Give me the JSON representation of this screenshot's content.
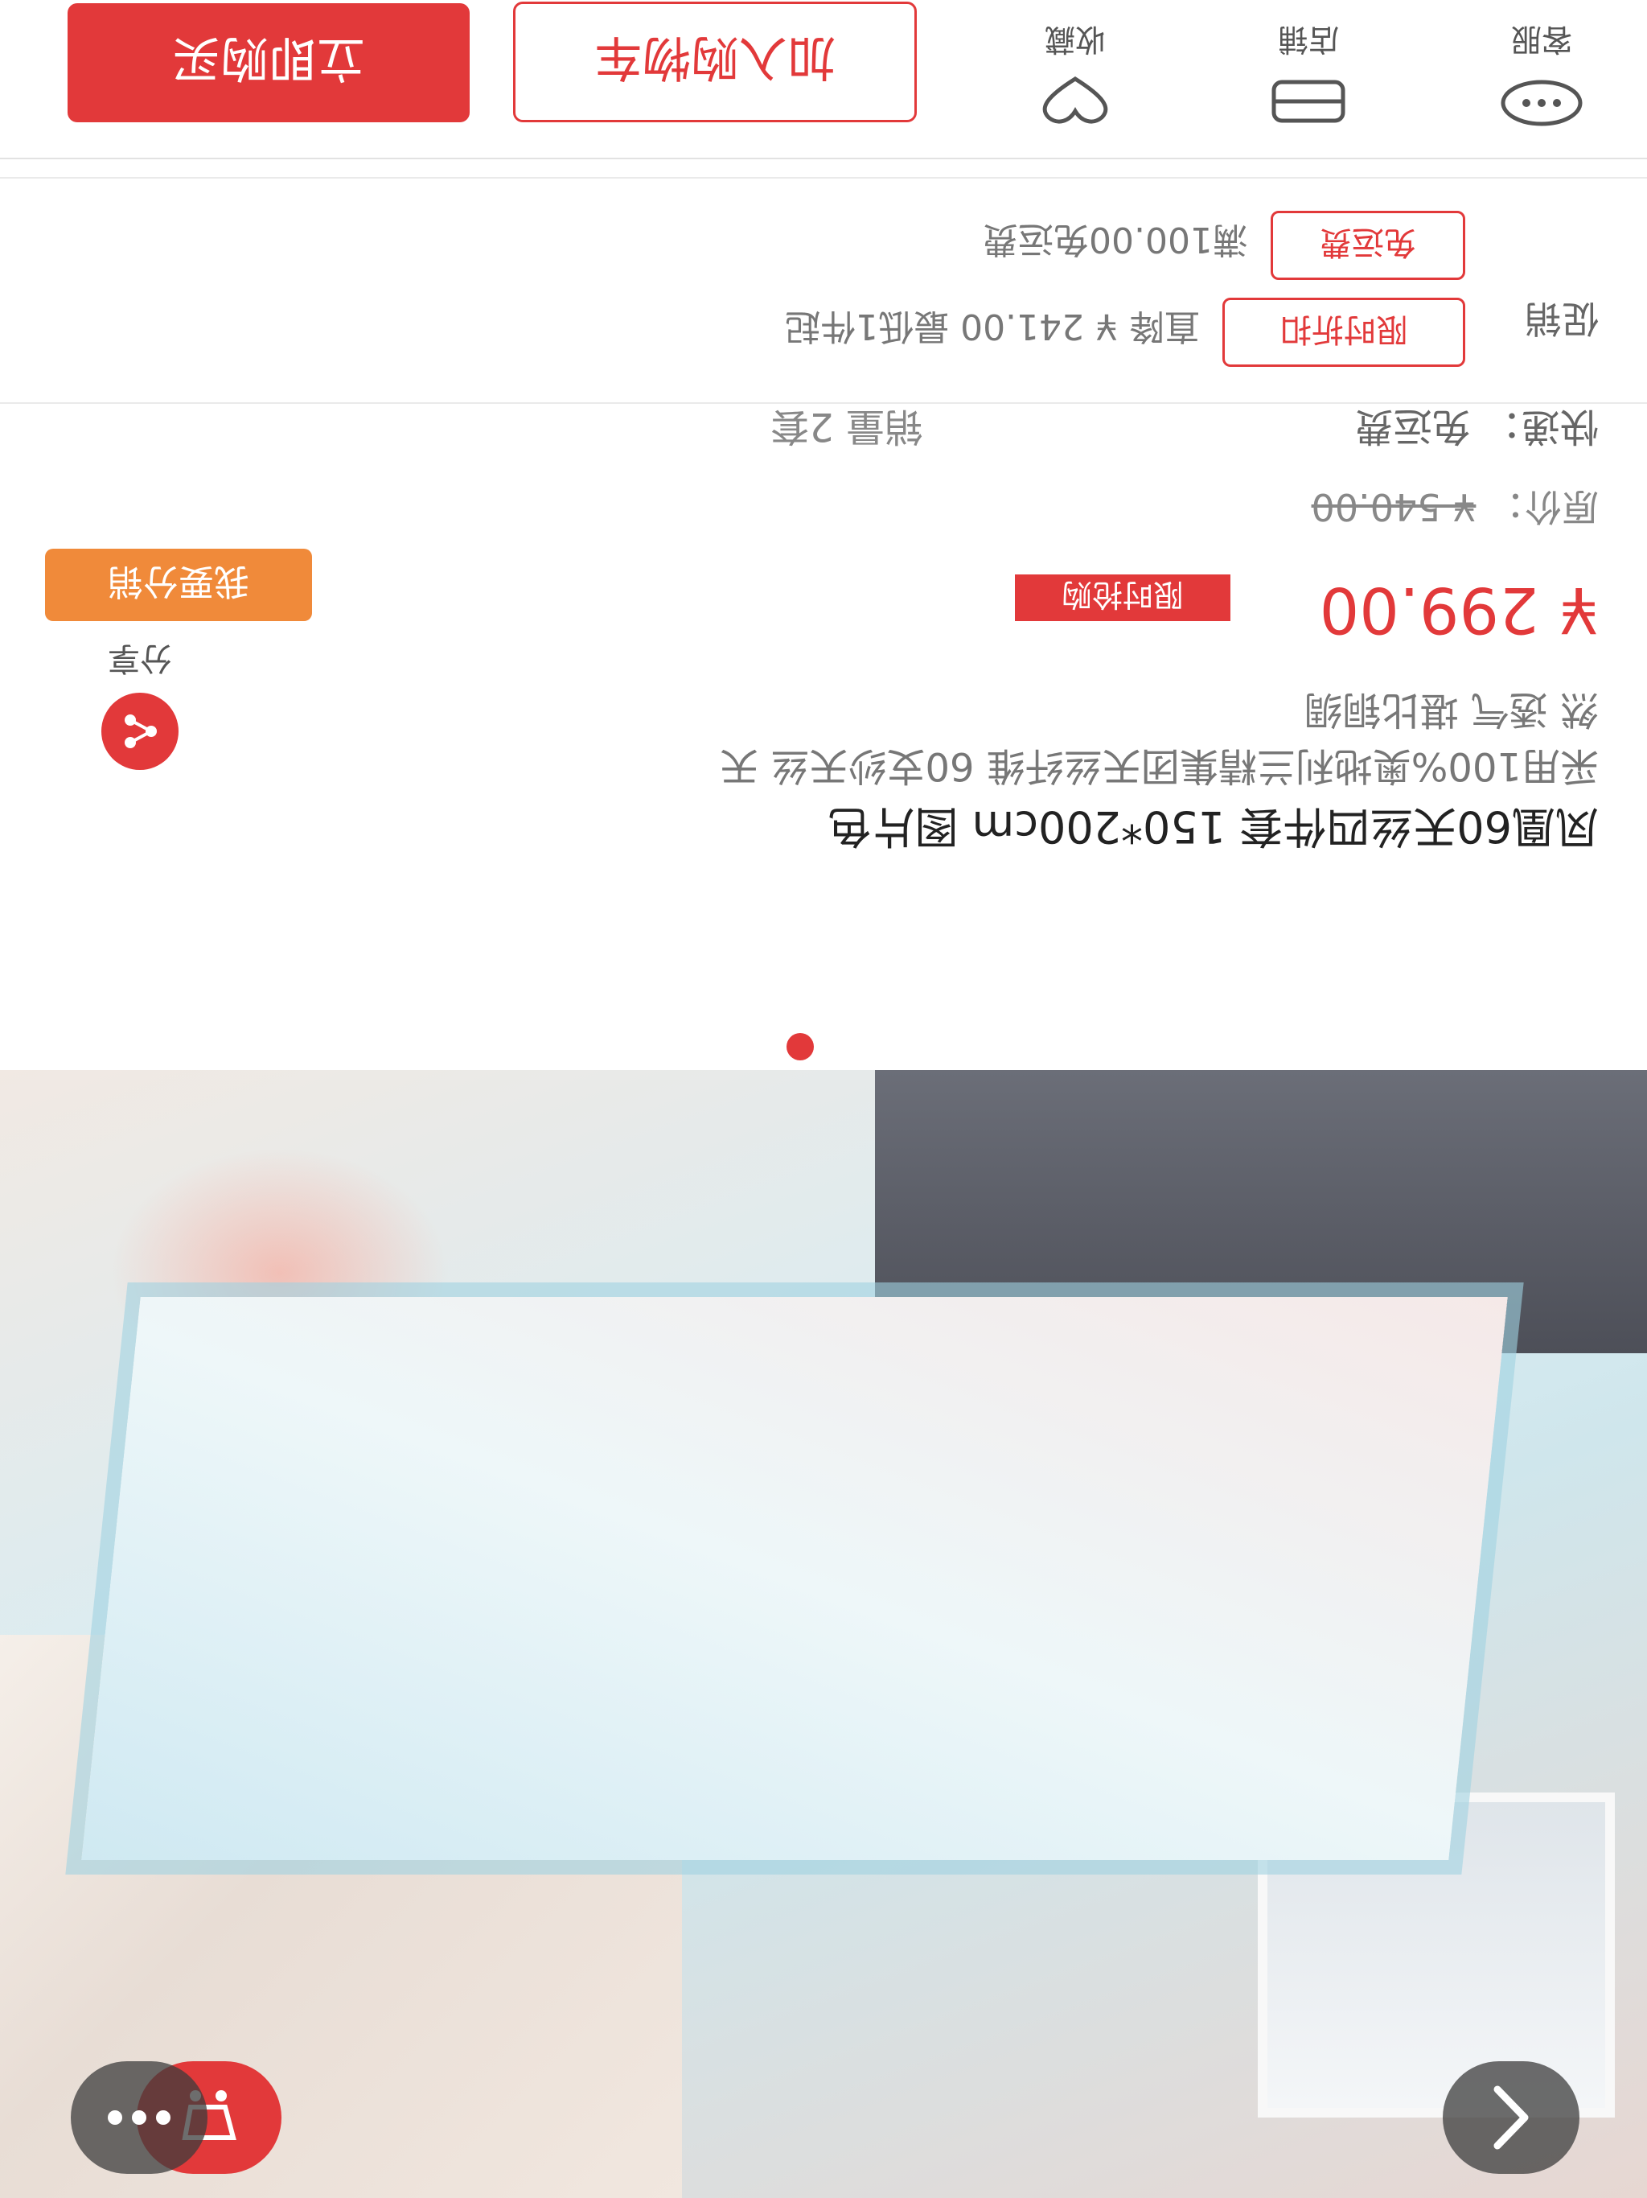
{
  "product": {
    "title": "凤凰60天丝四件套 150*200cm 图片色",
    "desc_line1": "采用100%奥地利兰精集团天丝纤维 60支纱天丝 天",
    "desc_line2": "然 透气 堪比铜绸",
    "price": "¥ 299.00",
    "flash_badge": "限时抢购",
    "original_price_label": "原价：",
    "original_price": "¥ 540.00",
    "express": "快递：  免运费",
    "sales": "销量 2套",
    "distribute_label": "我要分销",
    "share_label": "分享"
  },
  "promotions": {
    "label": "促销",
    "limit_tag": "限时折扣",
    "limit_text": "直降 ¥ 241.00  最低1件起",
    "free_tag": "免运费",
    "free_text": "满100.00免运费"
  },
  "bottom_nav": {
    "service": "客服",
    "store": "店铺",
    "favorite": "收藏",
    "add_to_cart": "加入购物车",
    "buy_now": "立即购买"
  },
  "colors": {
    "accent": "#e2393a",
    "distribute": "#f08a3a"
  }
}
